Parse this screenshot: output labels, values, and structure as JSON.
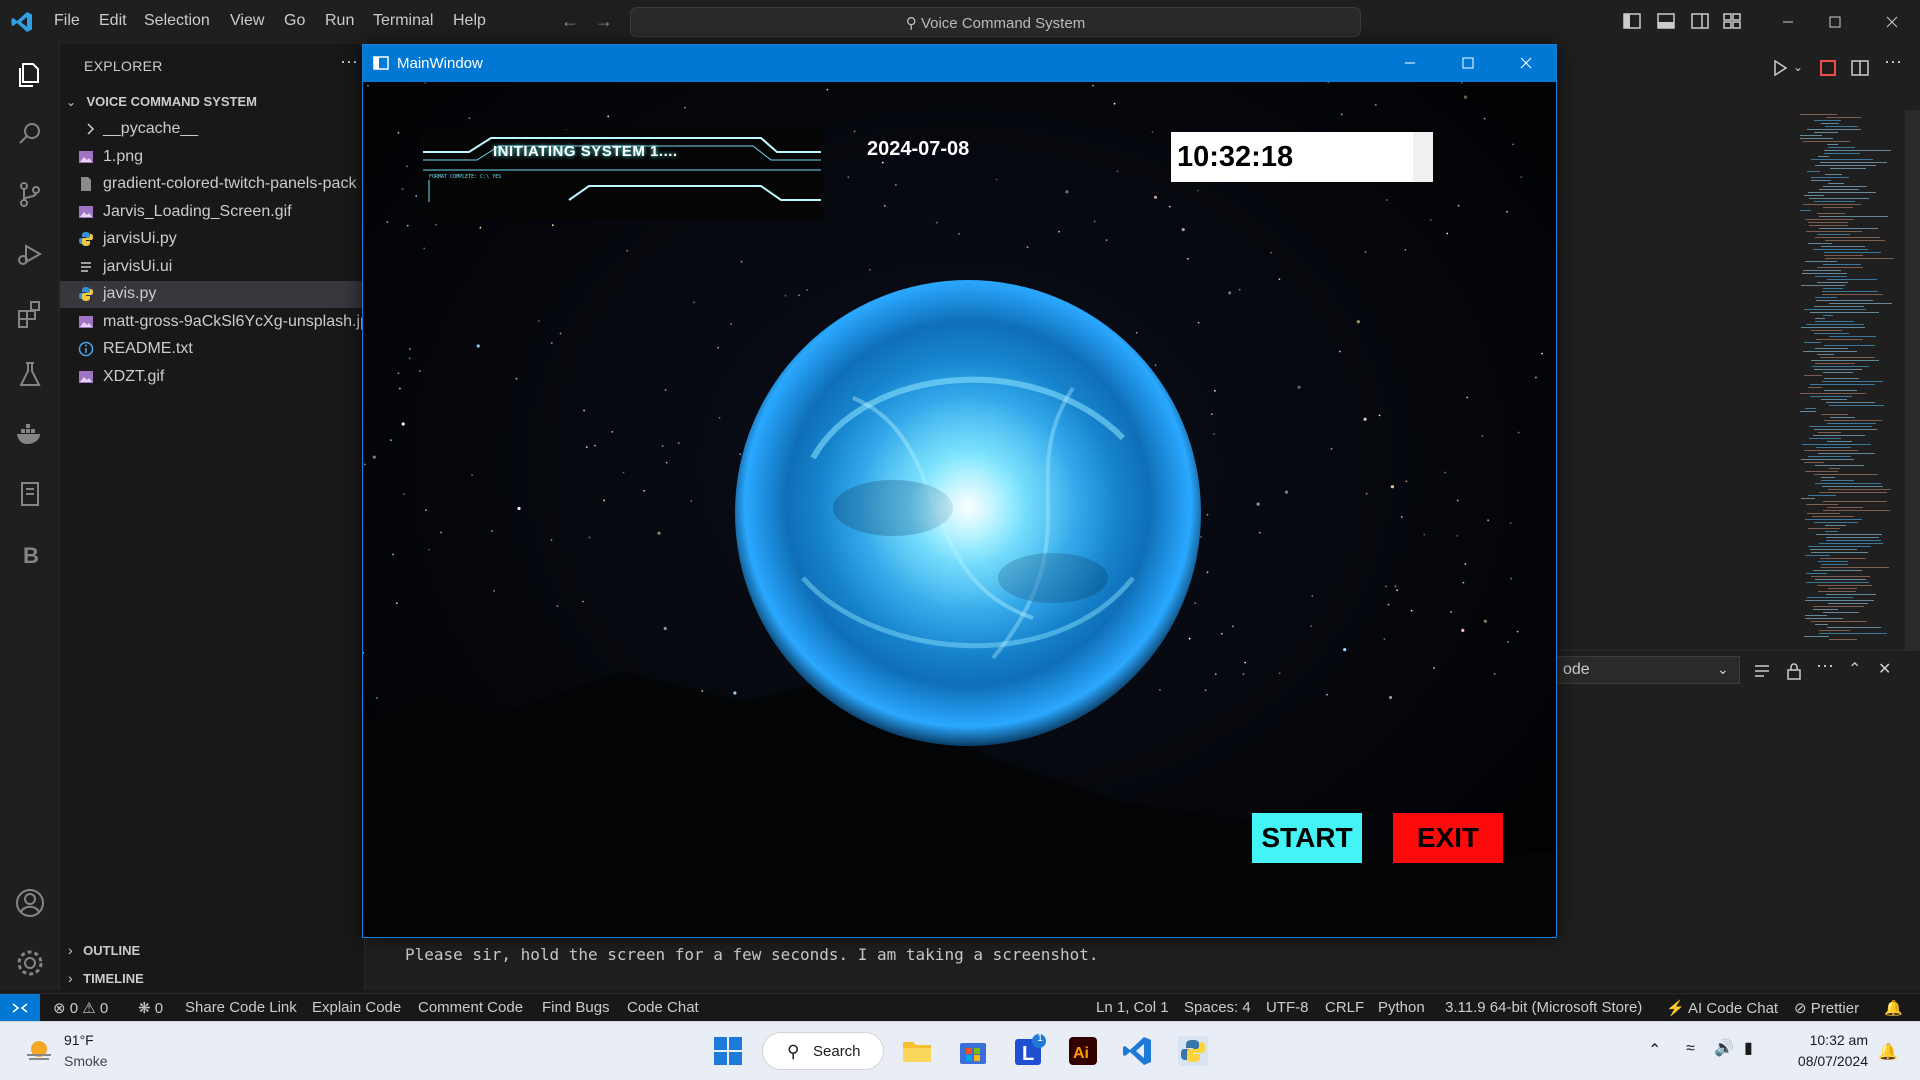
{
  "vscode": {
    "menu": [
      "File",
      "Edit",
      "Selection",
      "View",
      "Go",
      "Run",
      "Terminal",
      "Help"
    ],
    "command_center": "Voice Command System",
    "explorer_header": "EXPLORER",
    "project_name": "VOICE COMMAND SYSTEM",
    "files": [
      {
        "name": "__pycache__",
        "icon": "chevron-right-icon"
      },
      {
        "name": "1.png",
        "icon": "image-file-icon"
      },
      {
        "name": "gradient-colored-twitch-panels-pack",
        "icon": "file-icon"
      },
      {
        "name": "Jarvis_Loading_Screen.gif",
        "icon": "image-file-icon"
      },
      {
        "name": "jarvisUi.py",
        "icon": "python-file-icon"
      },
      {
        "name": "jarvisUi.ui",
        "icon": "text-file-icon"
      },
      {
        "name": "javis.py",
        "icon": "python-file-icon"
      },
      {
        "name": "matt-gross-9aCkSl6YcXg-unsplash.jpg",
        "icon": "image-file-icon"
      },
      {
        "name": "README.txt",
        "icon": "info-file-icon"
      },
      {
        "name": "XDZT.gif",
        "icon": "image-file-icon"
      }
    ],
    "outline": "OUTLINE",
    "timeline": "TIMELINE",
    "panel_dropdown": "ode",
    "terminal_output": "Please sir, hold the screen for a few seconds. I am taking a screenshot.",
    "status": {
      "errors": "0",
      "warnings": "0",
      "ports": "0",
      "share": "Share Code Link",
      "explain": "Explain Code",
      "comment": "Comment Code",
      "bugs": "Find Bugs",
      "chat": "Code Chat",
      "position": "Ln 1, Col 1",
      "spaces": "Spaces: 4",
      "encoding": "UTF-8",
      "eol": "CRLF",
      "language": "Python",
      "interpreter": "3.11.9 64-bit (Microsoft Store)",
      "ai_chat": "AI Code Chat",
      "prettier": "Prettier"
    }
  },
  "app_window": {
    "title": "MainWindow",
    "hud_text": "INITIATING SYSTEM 1....",
    "hud_subtext": "FORMAT COMPLETE: C:\\ YES",
    "date": "2024-07-08",
    "time": "10:32:18",
    "start_label": "START",
    "exit_label": "EXIT"
  },
  "taskbar": {
    "weather_temp": "91°F",
    "weather_desc": "Smoke",
    "search_label": "Search",
    "notification_badge": "1",
    "time": "10:32 am",
    "date": "08/07/2024"
  },
  "colors": {
    "vscode_accent": "#0078d4",
    "start_button": "#44f3f5",
    "exit_button": "#ff0a0a",
    "orb": "#2aa8ff"
  }
}
